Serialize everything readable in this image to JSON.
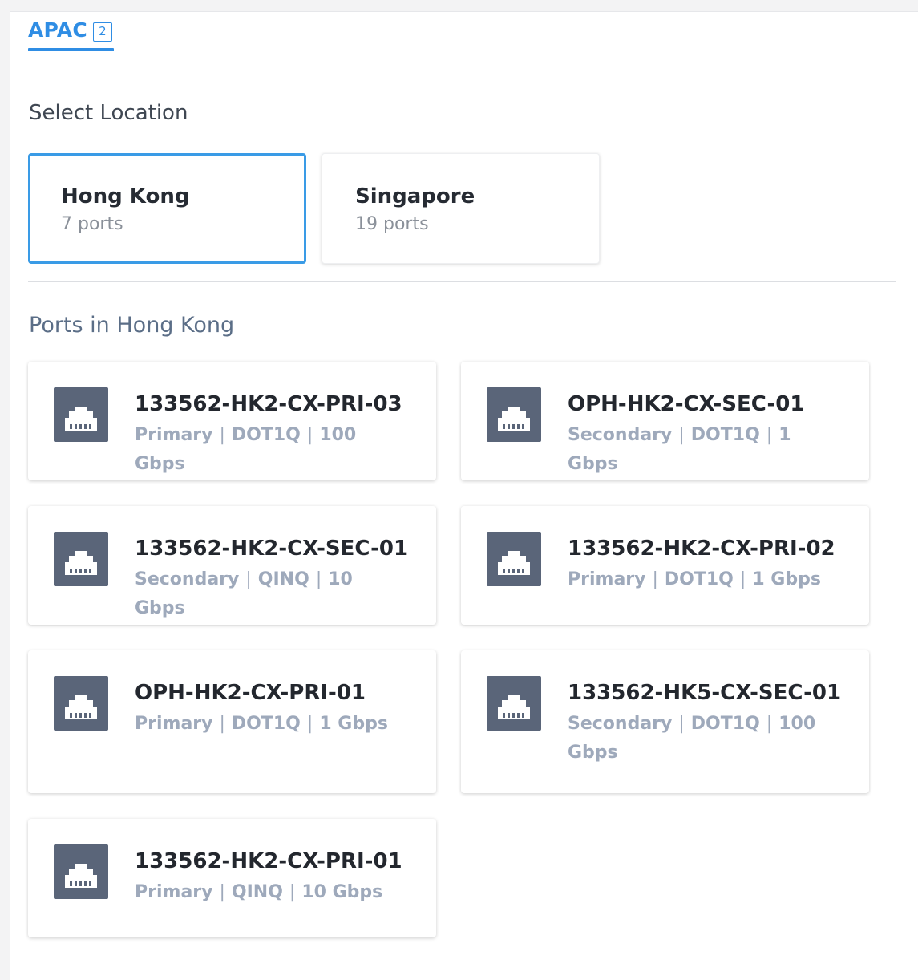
{
  "region_tab": {
    "label": "APAC",
    "count": "2"
  },
  "select_location_label": "Select Location",
  "locations": [
    {
      "name": "Hong Kong",
      "ports": "7 ports",
      "selected": true
    },
    {
      "name": "Singapore",
      "ports": "19 ports",
      "selected": false
    }
  ],
  "ports_heading": "Ports in Hong Kong",
  "ports": [
    {
      "name": "133562-HK2-CX-PRI-03",
      "role": "Primary",
      "vlan": "DOT1Q",
      "speed": "100 Gbps"
    },
    {
      "name": "OPH-HK2-CX-SEC-01",
      "role": "Secondary",
      "vlan": "DOT1Q",
      "speed": "1 Gbps"
    },
    {
      "name": "133562-HK2-CX-SEC-01",
      "role": "Secondary",
      "vlan": "QINQ",
      "speed": "10 Gbps"
    },
    {
      "name": "133562-HK2-CX-PRI-02",
      "role": "Primary",
      "vlan": "DOT1Q",
      "speed": "1 Gbps"
    },
    {
      "name": "OPH-HK2-CX-PRI-01",
      "role": "Primary",
      "vlan": "DOT1Q",
      "speed": "1 Gbps"
    },
    {
      "name": "133562-HK5-CX-SEC-01",
      "role": "Secondary",
      "vlan": "DOT1Q",
      "speed": "100 Gbps"
    },
    {
      "name": "133562-HK2-CX-PRI-01",
      "role": "Primary",
      "vlan": "QINQ",
      "speed": "10 Gbps"
    }
  ],
  "separator": "|",
  "port_icon": "ethernet-port-icon",
  "colors": {
    "accent": "#2f8de4",
    "selected_border": "#3a9be6",
    "icon_tile": "#5a6579"
  }
}
